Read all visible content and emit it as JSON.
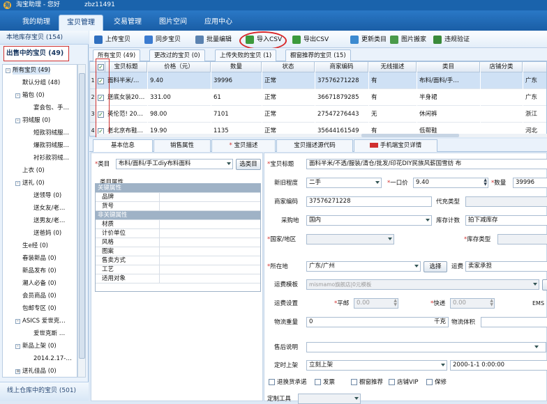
{
  "titlebar": {
    "app": "淘宝助理 - 您好",
    "user": "zbz11491"
  },
  "menu": {
    "tabs": [
      "我的助理",
      "宝贝管理",
      "交易管理",
      "图片空间",
      "应用中心"
    ]
  },
  "left": {
    "local_header": "本地库存宝贝 (154)",
    "selling": "出售中的宝贝 (49)",
    "tree": [
      {
        "label": "所有宝贝 (49)",
        "lvl": 0,
        "exp": "-",
        "sel": true
      },
      {
        "label": "默认分组 (48)",
        "lvl": 1
      },
      {
        "label": "箱包 (0)",
        "lvl": 1,
        "exp": "-"
      },
      {
        "label": "宴会包、手…",
        "lvl": 2
      },
      {
        "label": "羽绒服 (0)",
        "lvl": 1,
        "exp": "-"
      },
      {
        "label": "短款羽绒服…",
        "lvl": 2
      },
      {
        "label": "爆款羽绒服…",
        "lvl": 2
      },
      {
        "label": "衬衫款羽绒…",
        "lvl": 2
      },
      {
        "label": "上衣 (0)",
        "lvl": 1
      },
      {
        "label": "送礼 (0)",
        "lvl": 1,
        "exp": "-"
      },
      {
        "label": "送领导 (0)",
        "lvl": 2
      },
      {
        "label": "送女友/老…",
        "lvl": 2
      },
      {
        "label": "送男友/老…",
        "lvl": 2
      },
      {
        "label": "送爸妈 (0)",
        "lvl": 2
      },
      {
        "label": "生e经 (0)",
        "lvl": 1
      },
      {
        "label": "春装新品 (0)",
        "lvl": 1
      },
      {
        "label": "新品发布 (0)",
        "lvl": 1
      },
      {
        "label": "潮人必备 (0)",
        "lvl": 1
      },
      {
        "label": "会员商品 (0)",
        "lvl": 1
      },
      {
        "label": "包邮专区 (0)",
        "lvl": 1
      },
      {
        "label": "ASICS 爱世克…",
        "lvl": 1,
        "exp": "-"
      },
      {
        "label": "爱世克斯 …",
        "lvl": 2
      },
      {
        "label": "新品上架 (0)",
        "lvl": 1,
        "exp": "-"
      },
      {
        "label": "2014.2.17-…",
        "lvl": 2
      },
      {
        "label": "送礼佳品 (0)",
        "lvl": 1,
        "exp": "+"
      }
    ],
    "warehouse": "线上仓库中的宝贝 (501)"
  },
  "toolbar": {
    "items": [
      {
        "label": "上传宝贝",
        "icon": "upload-icon",
        "color": "#2f6fbf"
      },
      {
        "label": "同步宝贝",
        "icon": "sync-icon",
        "color": "#3b7bd0"
      },
      {
        "label": "批量编辑",
        "icon": "batch-edit-icon",
        "color": "#5a82b0"
      },
      {
        "label": "导入CSV",
        "icon": "import-csv-icon",
        "color": "#3c9a3c"
      },
      {
        "label": "导出CSV",
        "icon": "export-csv-icon",
        "color": "#3c9a3c"
      },
      {
        "label": "更新类目",
        "icon": "update-category-icon",
        "color": "#3c8ad0"
      },
      {
        "label": "图片搬家",
        "icon": "image-move-icon",
        "color": "#4a9a4a"
      },
      {
        "label": "违规验证",
        "icon": "violation-check-icon",
        "color": "#3a8a3a"
      }
    ]
  },
  "subtabs": [
    "所有宝贝 (49)",
    "更改过的宝贝 (0)",
    "上传失败的宝贝 (1)",
    "橱窗推荐的宝贝 (15)"
  ],
  "grid": {
    "headers": [
      "宝贝标题",
      "价格（元）",
      "数量",
      "状态",
      "商家编码",
      "无线描述",
      "类目",
      "店铺分类"
    ],
    "rows": [
      {
        "n": "1",
        "title": "面料半米/…",
        "price": "9.40",
        "qty": "39996",
        "status": "正常",
        "code": "37576271228",
        "wireless": "有",
        "cat": "布料/面料/手…",
        "region": "广东"
      },
      {
        "n": "2",
        "title": "送底女装20…",
        "price": "331.00",
        "qty": "61",
        "status": "正常",
        "code": "36671879285",
        "wireless": "有",
        "cat": "半身裙",
        "region": "广东"
      },
      {
        "n": "3",
        "title": "英伦范! 20…",
        "price": "98.00",
        "qty": "7101",
        "status": "正常",
        "code": "27547276443",
        "wireless": "无",
        "cat": "休闲裤",
        "region": "浙江"
      },
      {
        "n": "4",
        "title": "老北京布鞋…",
        "price": "19.90",
        "qty": "1135",
        "status": "正常",
        "code": "35644161549",
        "wireless": "有",
        "cat": "低帮鞋",
        "region": "河北"
      }
    ]
  },
  "detail_tabs": [
    "基本信息",
    "销售属性",
    "宝贝描述",
    "宝贝描述源代码",
    "手机端宝贝详情"
  ],
  "formL": {
    "cat_label": "类目",
    "cat_value": "布料/面料/手工diy布料面料",
    "cat_btn": "选类目",
    "attr_title": "类目属性",
    "key_attr": "关键属性",
    "key_items": [
      "品牌",
      "货号"
    ],
    "nonkey_attr": "非关键属性",
    "nonkey_items": [
      "材质",
      "计价单位",
      "风格",
      "图案",
      "售卖方式",
      "工艺",
      "适用对象"
    ]
  },
  "formR": {
    "title_label": "宝贝标题",
    "title_value": "面料半米/不透/服装/清仓/批发/印花DIY民族风薪国雪纺 布",
    "cond_label": "新旧程度",
    "cond_value": "二手",
    "price_label": "一口价",
    "price_value": "9.40",
    "qty_label": "数量",
    "qty_value": "39996",
    "code_label": "商家编码",
    "code_value": "37576271228",
    "agent_label": "代充类型",
    "origin_label": "采购地",
    "origin_value": "国内",
    "stock_label": "库存计数",
    "stock_value": "拍下减库存",
    "country_label": "国家/地区",
    "stocktype_label": "库存类型",
    "loc_label": "所在地",
    "loc_value": "广东/广州",
    "loc_btn": "选择",
    "freight_label": "运费",
    "freight_value": "卖家承担",
    "tpl_label": "运费模板",
    "tpl_value": "mismamo旗舰店|0元模板",
    "ship_label": "运费设置",
    "post_label": "平邮",
    "post_value": "0.00",
    "express_label": "快递",
    "express_value": "0.00",
    "ems_label": "EMS",
    "weight_label": "物流重量",
    "weight_value": "0",
    "weight_unit": "千克",
    "vol_label": "物流体积",
    "after_label": "售后说明",
    "timed_label": "定时上架",
    "timed_value": "立刻上架",
    "timed_date": "2000-1-1 0:00:00",
    "checks": [
      "退换货承诺",
      "发票",
      "橱窗推荐",
      "店铺VIP",
      "保修"
    ],
    "tool_label": "定制工具"
  }
}
